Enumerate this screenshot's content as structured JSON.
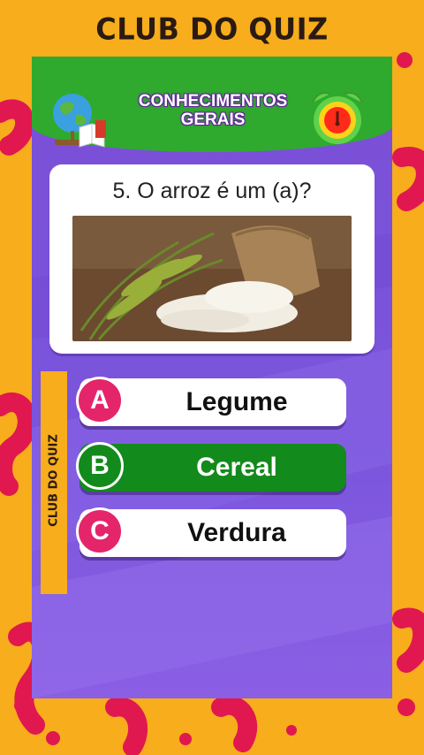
{
  "brand": {
    "title": "CLUB DO QUIZ"
  },
  "header": {
    "line1": "CONHECIMENTOS",
    "line2": "GERAIS"
  },
  "question": {
    "text": "5. O arroz é um (a)?"
  },
  "side_label": "CLUB DO QUIZ",
  "answers": [
    {
      "letter": "A",
      "text": "Legume",
      "state": "normal"
    },
    {
      "letter": "B",
      "text": "Cereal",
      "state": "correct"
    },
    {
      "letter": "C",
      "text": "Verdura",
      "state": "normal"
    }
  ],
  "colors": {
    "background": "#f7ad1c",
    "card": "#7b4fd6",
    "header": "#2faa2e",
    "correct": "#138a1c",
    "letter_badge": "#e4256a",
    "decor": "#e0184f"
  },
  "icons": [
    "globe-books-icon",
    "alarm-clock-icon",
    "rice-image"
  ]
}
